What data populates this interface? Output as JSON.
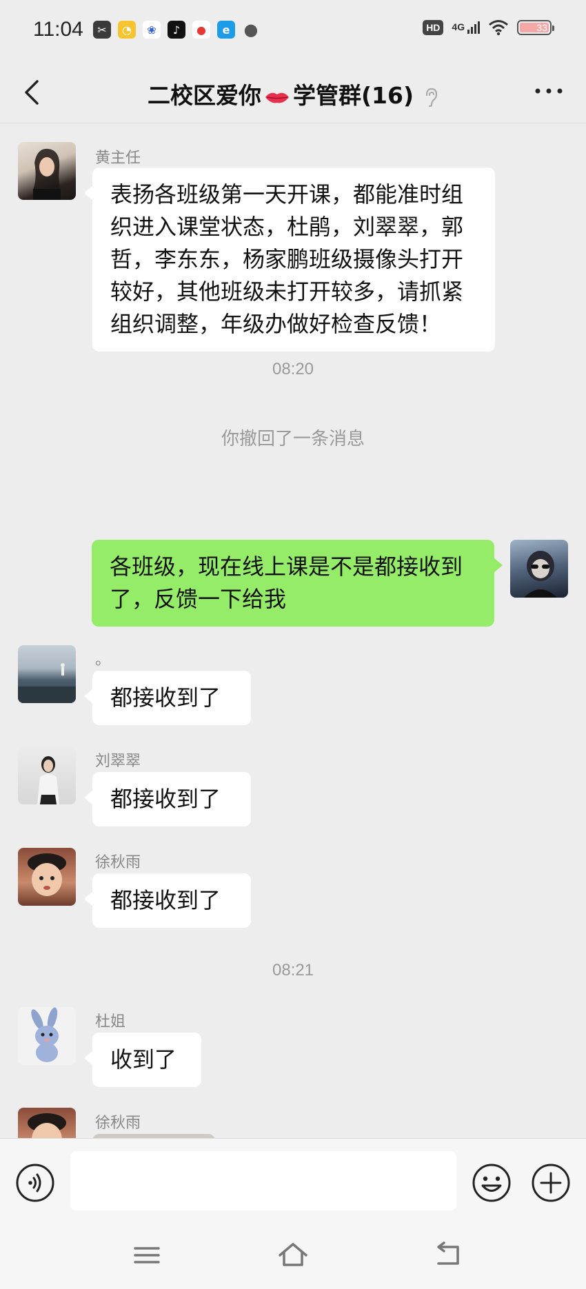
{
  "status_bar": {
    "time": "11:04",
    "hd_label": "HD",
    "network_label": "4G",
    "battery_level": "33",
    "app_icons": [
      "scissors-app-icon",
      "duck-app-icon",
      "baidu-paw-icon",
      "tiktok-icon",
      "map-pin-app-icon",
      "browser-e-icon",
      "chat-bubble-icon"
    ]
  },
  "header": {
    "title_before": "二校区爱你",
    "title_after": "学管群(16)",
    "icons": [
      "back-arrow-icon",
      "lips-emoji-icon",
      "ear-icon",
      "more-dots-icon"
    ]
  },
  "messages": {
    "m1": {
      "sender": "黄主任",
      "text": "表扬各班级第一天开课，都能准时组织进入课堂状态，杜鹃，刘翠翠，郭哲，李东东，杨家鹏班级摄像头打开较好，其他班级未打开较多，请抓紧组织调整，年级办做好检查反馈！"
    },
    "time1": "08:20",
    "system1": "你撤回了一条消息",
    "m2": {
      "text": "各班级，现在线上课是不是都接收到了，反馈一下给我"
    },
    "m3": {
      "sender": "。",
      "text": "都接收到了"
    },
    "m4": {
      "sender": "刘翠翠",
      "text": "都接收到了"
    },
    "m5": {
      "sender": "徐秋雨",
      "text": "都接收到了"
    },
    "time2": "08:21",
    "m6": {
      "sender": "杜姐",
      "text": "收到了"
    },
    "m7": {
      "sender": "徐秋雨"
    }
  },
  "input_bar": {
    "placeholder": "",
    "icons": [
      "voice-icon",
      "emoji-icon",
      "plus-icon"
    ]
  },
  "nav_bar": {
    "icons": [
      "menu-icon",
      "home-icon",
      "back-icon"
    ]
  },
  "colors": {
    "background": "#ededed",
    "sent_bubble": "#95ec69",
    "received_bubble": "#ffffff",
    "meta_text": "#999999"
  }
}
